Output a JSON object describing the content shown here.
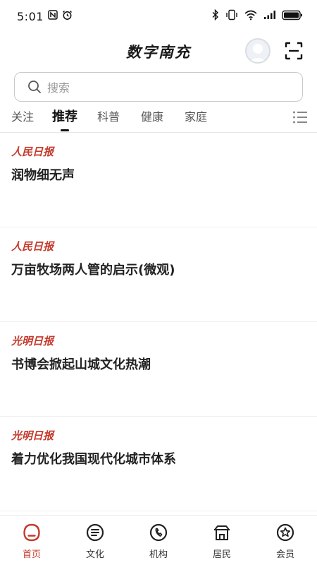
{
  "status_bar": {
    "time": "5:01",
    "left_icons": [
      "nfc-icon",
      "alarm-icon"
    ],
    "right_icons": [
      "bluetooth-icon",
      "vibrate-icon",
      "wifi-icon",
      "signal-icon",
      "battery-icon"
    ]
  },
  "header": {
    "title": "数字南充"
  },
  "search": {
    "placeholder": "搜索"
  },
  "tabs": [
    {
      "label": "关注",
      "active": false
    },
    {
      "label": "推荐",
      "active": true
    },
    {
      "label": "科普",
      "active": false
    },
    {
      "label": "健康",
      "active": false
    },
    {
      "label": "家庭",
      "active": false
    }
  ],
  "feed": [
    {
      "source": "人民日报",
      "title": "润物细无声"
    },
    {
      "source": "人民日报",
      "title": "万亩牧场两人管的启示(微观)"
    },
    {
      "source": "光明日报",
      "title": "书博会掀起山城文化热潮"
    },
    {
      "source": "光明日报",
      "title": "着力优化我国现代化城市体系"
    }
  ],
  "bottom_nav": [
    {
      "label": "首页",
      "icon": "home-icon",
      "active": true
    },
    {
      "label": "文化",
      "icon": "culture-icon",
      "active": false
    },
    {
      "label": "机构",
      "icon": "phone-icon",
      "active": false
    },
    {
      "label": "居民",
      "icon": "resident-icon",
      "active": false
    },
    {
      "label": "会员",
      "icon": "member-icon",
      "active": false
    }
  ],
  "colors": {
    "accent": "#c43a2c",
    "text": "#222222",
    "muted": "#9a9a9a"
  }
}
